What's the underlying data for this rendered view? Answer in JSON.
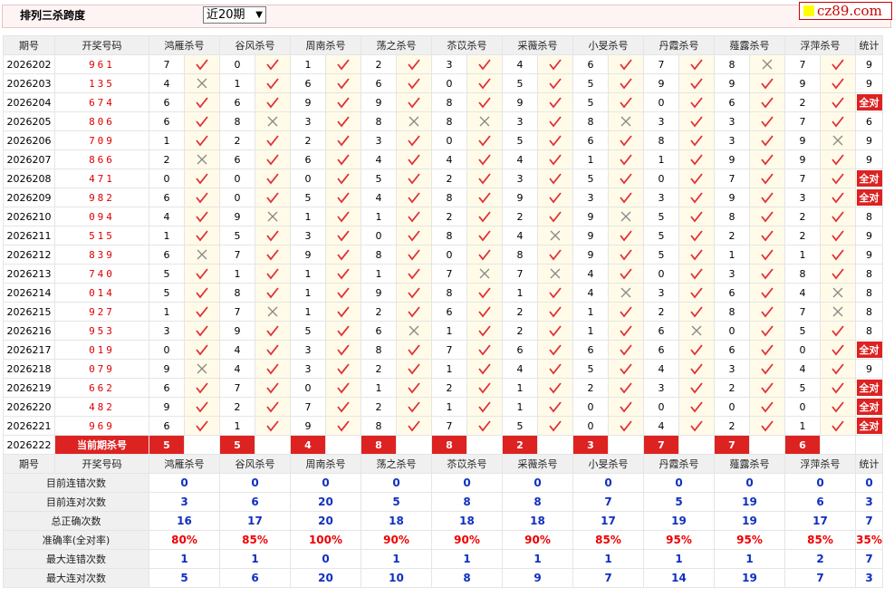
{
  "header": {
    "title": "排列三杀跨度",
    "period_select": "近20期",
    "logo_text": "cz89.com"
  },
  "columns": [
    "期号",
    "开奖号码",
    "鸿雁杀号",
    "谷风杀号",
    "周南杀号",
    "荡之杀号",
    "苶苡杀号",
    "采薇杀号",
    "小旻杀号",
    "丹霞杀号",
    "薤露杀号",
    "浮萍杀号",
    "统计"
  ],
  "rows": [
    {
      "issue": "2026202",
      "draw": "961",
      "kills": [
        [
          "7",
          1
        ],
        [
          "0",
          1
        ],
        [
          "1",
          1
        ],
        [
          "2",
          1
        ],
        [
          "3",
          1
        ],
        [
          "4",
          1
        ],
        [
          "6",
          1
        ],
        [
          "7",
          1
        ],
        [
          "8",
          0
        ],
        [
          "7",
          1
        ]
      ],
      "stat": "9"
    },
    {
      "issue": "2026203",
      "draw": "135",
      "kills": [
        [
          "4",
          0
        ],
        [
          "1",
          1
        ],
        [
          "6",
          1
        ],
        [
          "6",
          1
        ],
        [
          "0",
          1
        ],
        [
          "5",
          1
        ],
        [
          "5",
          1
        ],
        [
          "9",
          1
        ],
        [
          "9",
          1
        ],
        [
          "9",
          1
        ]
      ],
      "stat": "9"
    },
    {
      "issue": "2026204",
      "draw": "674",
      "kills": [
        [
          "6",
          1
        ],
        [
          "6",
          1
        ],
        [
          "9",
          1
        ],
        [
          "9",
          1
        ],
        [
          "8",
          1
        ],
        [
          "9",
          1
        ],
        [
          "5",
          1
        ],
        [
          "0",
          1
        ],
        [
          "6",
          1
        ],
        [
          "2",
          1
        ]
      ],
      "stat": "全对"
    },
    {
      "issue": "2026205",
      "draw": "806",
      "kills": [
        [
          "6",
          1
        ],
        [
          "8",
          0
        ],
        [
          "3",
          1
        ],
        [
          "8",
          0
        ],
        [
          "8",
          0
        ],
        [
          "3",
          1
        ],
        [
          "8",
          0
        ],
        [
          "3",
          1
        ],
        [
          "3",
          1
        ],
        [
          "7",
          1
        ]
      ],
      "stat": "6"
    },
    {
      "issue": "2026206",
      "draw": "709",
      "kills": [
        [
          "1",
          1
        ],
        [
          "2",
          1
        ],
        [
          "2",
          1
        ],
        [
          "3",
          1
        ],
        [
          "0",
          1
        ],
        [
          "5",
          1
        ],
        [
          "6",
          1
        ],
        [
          "8",
          1
        ],
        [
          "3",
          1
        ],
        [
          "9",
          0
        ]
      ],
      "stat": "9"
    },
    {
      "issue": "2026207",
      "draw": "866",
      "kills": [
        [
          "2",
          0
        ],
        [
          "6",
          1
        ],
        [
          "6",
          1
        ],
        [
          "4",
          1
        ],
        [
          "4",
          1
        ],
        [
          "4",
          1
        ],
        [
          "1",
          1
        ],
        [
          "1",
          1
        ],
        [
          "9",
          1
        ],
        [
          "9",
          1
        ]
      ],
      "stat": "9"
    },
    {
      "issue": "2026208",
      "draw": "471",
      "kills": [
        [
          "0",
          1
        ],
        [
          "0",
          1
        ],
        [
          "0",
          1
        ],
        [
          "5",
          1
        ],
        [
          "2",
          1
        ],
        [
          "3",
          1
        ],
        [
          "5",
          1
        ],
        [
          "0",
          1
        ],
        [
          "7",
          1
        ],
        [
          "7",
          1
        ]
      ],
      "stat": "全对"
    },
    {
      "issue": "2026209",
      "draw": "982",
      "kills": [
        [
          "6",
          1
        ],
        [
          "0",
          1
        ],
        [
          "5",
          1
        ],
        [
          "4",
          1
        ],
        [
          "8",
          1
        ],
        [
          "9",
          1
        ],
        [
          "3",
          1
        ],
        [
          "3",
          1
        ],
        [
          "9",
          1
        ],
        [
          "3",
          1
        ]
      ],
      "stat": "全对"
    },
    {
      "issue": "2026210",
      "draw": "094",
      "kills": [
        [
          "4",
          1
        ],
        [
          "9",
          0
        ],
        [
          "1",
          1
        ],
        [
          "1",
          1
        ],
        [
          "2",
          1
        ],
        [
          "2",
          1
        ],
        [
          "9",
          0
        ],
        [
          "5",
          1
        ],
        [
          "8",
          1
        ],
        [
          "2",
          1
        ]
      ],
      "stat": "8"
    },
    {
      "issue": "2026211",
      "draw": "515",
      "kills": [
        [
          "1",
          1
        ],
        [
          "5",
          1
        ],
        [
          "3",
          1
        ],
        [
          "0",
          1
        ],
        [
          "8",
          1
        ],
        [
          "4",
          0
        ],
        [
          "9",
          1
        ],
        [
          "5",
          1
        ],
        [
          "2",
          1
        ],
        [
          "2",
          1
        ]
      ],
      "stat": "9"
    },
    {
      "issue": "2026212",
      "draw": "839",
      "kills": [
        [
          "6",
          0
        ],
        [
          "7",
          1
        ],
        [
          "9",
          1
        ],
        [
          "8",
          1
        ],
        [
          "0",
          1
        ],
        [
          "8",
          1
        ],
        [
          "9",
          1
        ],
        [
          "5",
          1
        ],
        [
          "1",
          1
        ],
        [
          "1",
          1
        ]
      ],
      "stat": "9"
    },
    {
      "issue": "2026213",
      "draw": "740",
      "kills": [
        [
          "5",
          1
        ],
        [
          "1",
          1
        ],
        [
          "1",
          1
        ],
        [
          "1",
          1
        ],
        [
          "7",
          0
        ],
        [
          "7",
          0
        ],
        [
          "4",
          1
        ],
        [
          "0",
          1
        ],
        [
          "3",
          1
        ],
        [
          "8",
          1
        ]
      ],
      "stat": "8"
    },
    {
      "issue": "2026214",
      "draw": "014",
      "kills": [
        [
          "5",
          1
        ],
        [
          "8",
          1
        ],
        [
          "1",
          1
        ],
        [
          "9",
          1
        ],
        [
          "8",
          1
        ],
        [
          "1",
          1
        ],
        [
          "4",
          0
        ],
        [
          "3",
          1
        ],
        [
          "6",
          1
        ],
        [
          "4",
          0
        ]
      ],
      "stat": "8"
    },
    {
      "issue": "2026215",
      "draw": "927",
      "kills": [
        [
          "1",
          1
        ],
        [
          "7",
          0
        ],
        [
          "1",
          1
        ],
        [
          "2",
          1
        ],
        [
          "6",
          1
        ],
        [
          "2",
          1
        ],
        [
          "1",
          1
        ],
        [
          "2",
          1
        ],
        [
          "8",
          1
        ],
        [
          "7",
          0
        ]
      ],
      "stat": "8"
    },
    {
      "issue": "2026216",
      "draw": "953",
      "kills": [
        [
          "3",
          1
        ],
        [
          "9",
          1
        ],
        [
          "5",
          1
        ],
        [
          "6",
          0
        ],
        [
          "1",
          1
        ],
        [
          "2",
          1
        ],
        [
          "1",
          1
        ],
        [
          "6",
          0
        ],
        [
          "0",
          1
        ],
        [
          "5",
          1
        ]
      ],
      "stat": "8"
    },
    {
      "issue": "2026217",
      "draw": "019",
      "kills": [
        [
          "0",
          1
        ],
        [
          "4",
          1
        ],
        [
          "3",
          1
        ],
        [
          "8",
          1
        ],
        [
          "7",
          1
        ],
        [
          "6",
          1
        ],
        [
          "6",
          1
        ],
        [
          "6",
          1
        ],
        [
          "6",
          1
        ],
        [
          "0",
          1
        ]
      ],
      "stat": "全对"
    },
    {
      "issue": "2026218",
      "draw": "079",
      "kills": [
        [
          "9",
          0
        ],
        [
          "4",
          1
        ],
        [
          "3",
          1
        ],
        [
          "2",
          1
        ],
        [
          "1",
          1
        ],
        [
          "4",
          1
        ],
        [
          "5",
          1
        ],
        [
          "4",
          1
        ],
        [
          "3",
          1
        ],
        [
          "4",
          1
        ]
      ],
      "stat": "9"
    },
    {
      "issue": "2026219",
      "draw": "662",
      "kills": [
        [
          "6",
          1
        ],
        [
          "7",
          1
        ],
        [
          "0",
          1
        ],
        [
          "1",
          1
        ],
        [
          "2",
          1
        ],
        [
          "1",
          1
        ],
        [
          "2",
          1
        ],
        [
          "3",
          1
        ],
        [
          "2",
          1
        ],
        [
          "5",
          1
        ]
      ],
      "stat": "全对"
    },
    {
      "issue": "2026220",
      "draw": "482",
      "kills": [
        [
          "9",
          1
        ],
        [
          "2",
          1
        ],
        [
          "7",
          1
        ],
        [
          "2",
          1
        ],
        [
          "1",
          1
        ],
        [
          "1",
          1
        ],
        [
          "0",
          1
        ],
        [
          "0",
          1
        ],
        [
          "0",
          1
        ],
        [
          "0",
          1
        ]
      ],
      "stat": "全对"
    },
    {
      "issue": "2026221",
      "draw": "969",
      "kills": [
        [
          "6",
          1
        ],
        [
          "1",
          1
        ],
        [
          "9",
          1
        ],
        [
          "8",
          1
        ],
        [
          "7",
          1
        ],
        [
          "5",
          1
        ],
        [
          "0",
          1
        ],
        [
          "4",
          1
        ],
        [
          "2",
          1
        ],
        [
          "1",
          1
        ]
      ],
      "stat": "全对"
    }
  ],
  "current": {
    "issue": "2026222",
    "label": "当前期杀号",
    "kills": [
      "5",
      "5",
      "4",
      "8",
      "8",
      "2",
      "3",
      "7",
      "7",
      "6"
    ]
  },
  "stats": [
    {
      "label": "目前连错次数",
      "values": [
        "0",
        "0",
        "0",
        "0",
        "0",
        "0",
        "0",
        "0",
        "0",
        "0",
        "0"
      ]
    },
    {
      "label": "目前连对次数",
      "values": [
        "3",
        "6",
        "20",
        "5",
        "8",
        "8",
        "7",
        "5",
        "19",
        "6",
        "3"
      ]
    },
    {
      "label": "总正确次数",
      "values": [
        "16",
        "17",
        "20",
        "18",
        "18",
        "18",
        "17",
        "19",
        "19",
        "17",
        "7"
      ]
    },
    {
      "label": "准确率(全对率)",
      "values": [
        "80%",
        "85%",
        "100%",
        "90%",
        "90%",
        "90%",
        "85%",
        "95%",
        "95%",
        "85%",
        "35%"
      ],
      "red": true
    },
    {
      "label": "最大连错次数",
      "values": [
        "1",
        "1",
        "0",
        "1",
        "1",
        "1",
        "1",
        "1",
        "1",
        "2",
        "7"
      ]
    },
    {
      "label": "最大连对次数",
      "values": [
        "5",
        "6",
        "20",
        "10",
        "8",
        "9",
        "7",
        "14",
        "19",
        "7",
        "3"
      ]
    }
  ],
  "colors": {
    "accent": "#d22222",
    "check": "#e0303a",
    "cross": "#888888",
    "stat_blue": "#1030c0"
  },
  "icons": {
    "correct": "check-icon",
    "wrong": "cross-icon"
  }
}
